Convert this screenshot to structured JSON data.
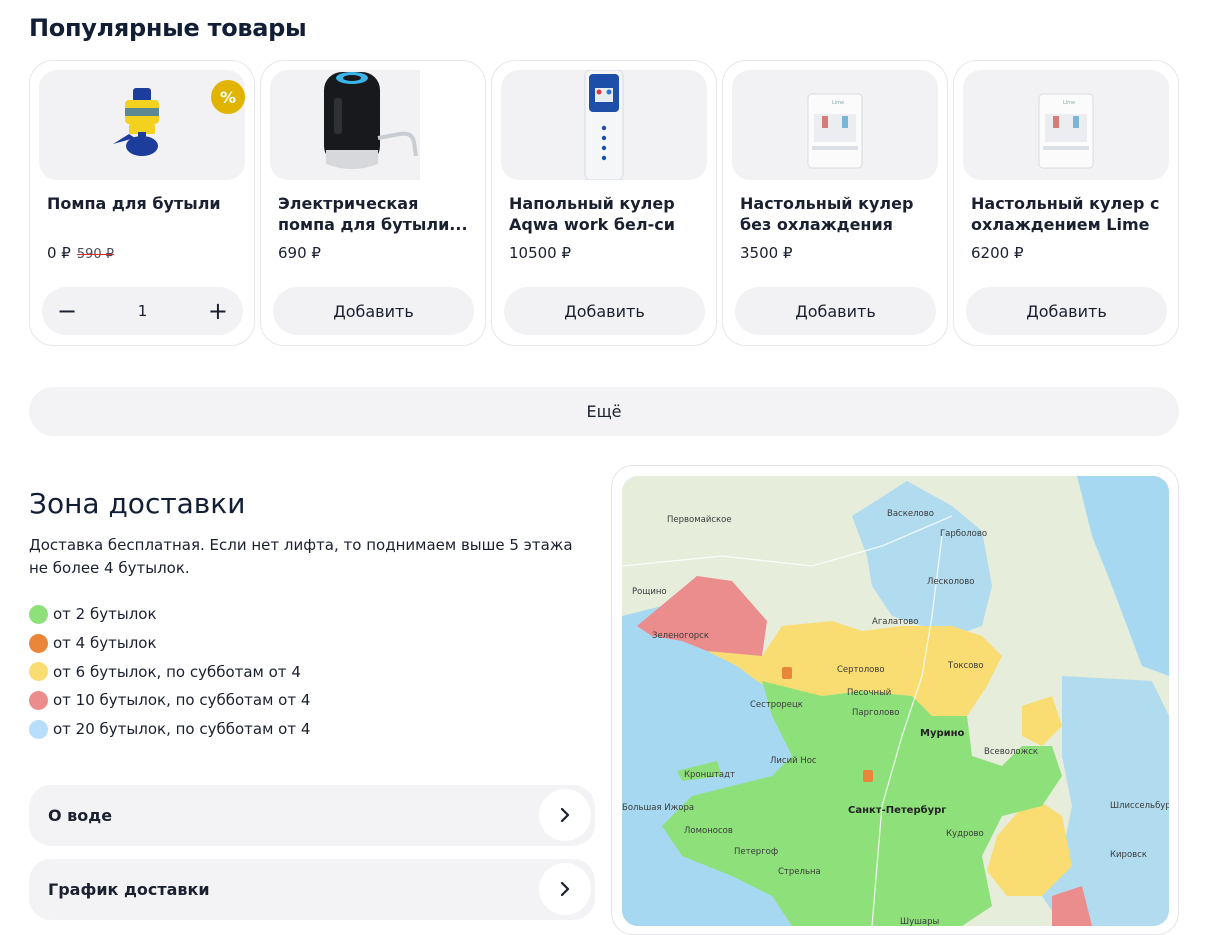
{
  "popular": {
    "title": "Популярные товары",
    "products": [
      {
        "name": "Помпа для бутыли",
        "price": "0 ₽",
        "old_price": "590 ₽",
        "badge": "%",
        "quantity": "1",
        "minus": "−",
        "plus": "+"
      },
      {
        "name": "Электрическая помпа для бутыли...",
        "price": "690 ₽",
        "button": "Добавить"
      },
      {
        "name": "Напольный кулер Aqwa work бел-си",
        "price": "10500 ₽",
        "button": "Добавить"
      },
      {
        "name": "Настольный кулер без охлаждения Lime",
        "price": "3500 ₽",
        "button": "Добавить"
      },
      {
        "name": "Настольный кулер с охлаждением Lime",
        "price": "6200 ₽",
        "button": "Добавить"
      }
    ],
    "more_button": "Ещё"
  },
  "delivery": {
    "title": "Зона доставки",
    "description": "Доставка бесплатная. Если нет лифта, то поднимаем выше 5 этажа не более 4 бутылок.",
    "legend": [
      {
        "label": "от 2 бутылок",
        "color": "#8ee07b"
      },
      {
        "label": "от 4 бутылок",
        "color": "#e9863a"
      },
      {
        "label": "от 6 бутылок, по субботам от 4",
        "color": "#f9dd72"
      },
      {
        "label": "от 10 бутылок, по субботам от 4",
        "color": "#ec8d8d"
      },
      {
        "label": "от 20 бутылок, по субботам от 4",
        "color": "#b7defa"
      }
    ],
    "accordion": [
      {
        "label": "О воде"
      },
      {
        "label": "График доставки"
      }
    ]
  },
  "map": {
    "places": [
      "Первомайское",
      "Васкелово",
      "Гарболово",
      "Лесколово",
      "Рощино",
      "Зеленогорск",
      "Агалатово",
      "Сертолово",
      "Токсово",
      "Песочный",
      "Сестрорецк",
      "Парголово",
      "Мурино",
      "Всеволожск",
      "Лисий Нос",
      "Кронштадт",
      "Санкт-Петербург",
      "Большая Ижора",
      "Шлиссельбург",
      "Ломоносов",
      "Петергоф",
      "Кудрово",
      "Стрельна",
      "Кировск",
      "Шушары"
    ]
  }
}
